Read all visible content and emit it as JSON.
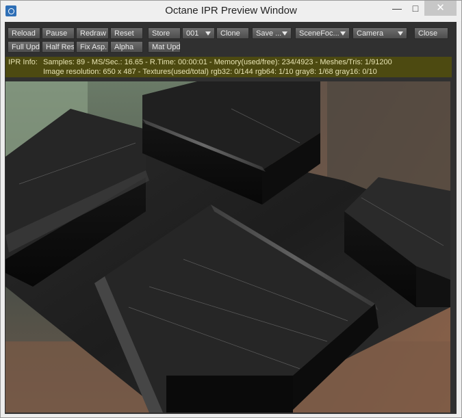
{
  "window": {
    "title": "Octane IPR Preview Window",
    "controls": {
      "minimize": "—",
      "maximize": "□",
      "close": "✕"
    }
  },
  "toolbar": {
    "row1": {
      "reload": "Reload",
      "pause": "Pause",
      "redraw": "Redraw",
      "reset": "Reset",
      "store": "Store",
      "slot": "001",
      "clone": "Clone",
      "save": "Save ...",
      "scene_focus": "SceneFoc...",
      "camera": "Camera",
      "close": "Close"
    },
    "row2": {
      "full_update": "Full Upd.",
      "half_res": "Half Res",
      "fix_aspect": "Fix Asp.",
      "alpha": "Alpha",
      "mat_update": "Mat Upd"
    }
  },
  "info": {
    "label": "IPR Info:",
    "line1": "Samples: 89  -  MS/Sec.: 16.65  -  R.Time: 00:00:01 - Memory(used/free): 234/4923  -  Meshes/Tris: 1/91200",
    "line2": "Image resolution: 650 x 487 - Textures(used/total) rgb32: 0/144   rgb64: 1/10   gray8: 1/68   gray16: 0/10"
  },
  "colors": {
    "info_bg": "#4d4a11",
    "info_text": "#e7e3b3",
    "panel_bg": "#303030",
    "button_bg": "#5b5b5b",
    "close_hover": "#c7c7c7"
  }
}
